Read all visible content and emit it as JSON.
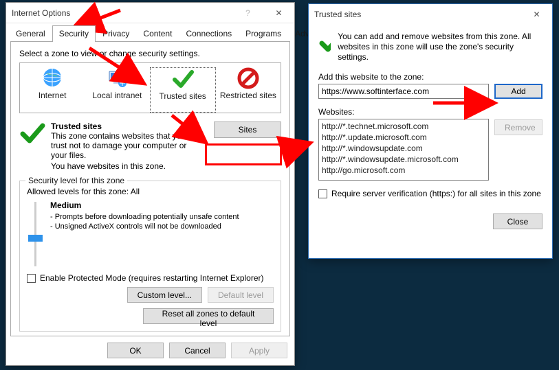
{
  "io": {
    "title": "Internet Options",
    "tabs": [
      "General",
      "Security",
      "Privacy",
      "Content",
      "Connections",
      "Programs",
      "Advanced"
    ],
    "active_tab": "Security",
    "zone_prompt": "Select a zone to view or change security settings.",
    "zones": [
      "Internet",
      "Local intranet",
      "Trusted sites",
      "Restricted sites"
    ],
    "selected_zone": "Trusted sites",
    "desc_title": "Trusted sites",
    "desc_body1": "This zone contains websites that you trust not to damage your computer or your files.",
    "desc_body2": "You have websites in this zone.",
    "sites_btn": "Sites",
    "sec_legend": "Security level for this zone",
    "allowed": "Allowed levels for this zone: All",
    "level": "Medium",
    "level_line1": "- Prompts before downloading potentially unsafe content",
    "level_line2": "- Unsigned ActiveX controls will not be downloaded",
    "epm": "Enable Protected Mode (requires restarting Internet Explorer)",
    "custom_btn": "Custom level...",
    "default_btn": "Default level",
    "reset_btn": "Reset all zones to default level",
    "ok": "OK",
    "cancel": "Cancel",
    "apply": "Apply"
  },
  "ts": {
    "title": "Trusted sites",
    "intro": "You can add and remove websites from this zone. All websites in this zone will use the zone's security settings.",
    "add_label": "Add this website to the zone:",
    "url": "https://www.softinterface.com",
    "add_btn": "Add",
    "websites_label": "Websites:",
    "sites": [
      "http://*.technet.microsoft.com",
      "http://*.update.microsoft.com",
      "http://*.windowsupdate.com",
      "http://*.windowsupdate.microsoft.com",
      "http://go.microsoft.com"
    ],
    "remove_btn": "Remove",
    "require": "Require server verification (https:) for all sites in this zone",
    "close": "Close"
  }
}
